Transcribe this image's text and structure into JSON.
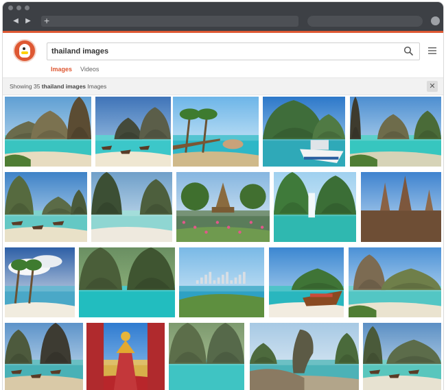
{
  "browser": {
    "new_tab_glyph": "+",
    "back_glyph": "◀",
    "forward_glyph": "▶"
  },
  "search": {
    "query": "thailand images",
    "icon": "magnifier-icon"
  },
  "tabs": [
    {
      "label": "Images",
      "active": true
    },
    {
      "label": "Videos",
      "active": false
    }
  ],
  "results": {
    "prefix": "Showing 35 ",
    "query": "thailand images",
    "suffix": " Images",
    "close_glyph": "✕"
  },
  "colors": {
    "accent": "#de5833",
    "chrome": "#3d4045"
  },
  "images": [
    {
      "scene": "bay-cliffs"
    },
    {
      "scene": "cove-boats"
    },
    {
      "scene": "pier-palms"
    },
    {
      "scene": "boat-cliff"
    },
    {
      "scene": "bay-island"
    },
    {
      "scene": "longtail-cliffs"
    },
    {
      "scene": "beach-cliff"
    },
    {
      "scene": "temple-garden"
    },
    {
      "scene": "waterfall-lagoon"
    },
    {
      "scene": "ancient-ruins"
    },
    {
      "scene": "stormy-beach"
    },
    {
      "scene": "lagoon-cliffs"
    },
    {
      "scene": "city-coast"
    },
    {
      "scene": "longtail-island"
    },
    {
      "scene": "railay-cliffs"
    },
    {
      "scene": "beach-boats"
    },
    {
      "scene": "golden-buddha"
    },
    {
      "scene": "cliff-lagoon"
    },
    {
      "scene": "james-bond-rock"
    },
    {
      "scene": "cliff-boats"
    }
  ]
}
